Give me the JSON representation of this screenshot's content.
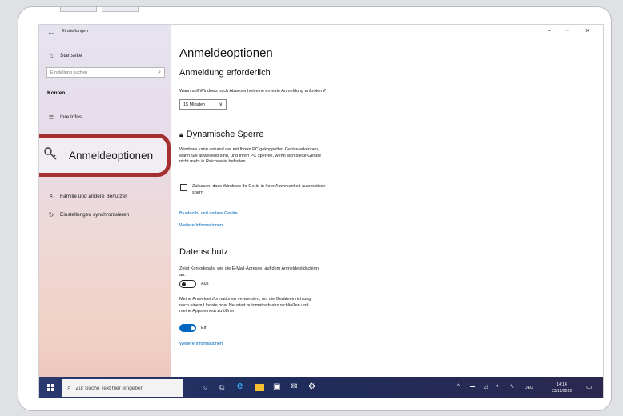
{
  "sidebar": {
    "window_title": "Einstellungen",
    "home": "Startseite",
    "search_placeholder": "Einstellung suchen",
    "section": "Konten",
    "items": [
      {
        "label": "Ihre Infos",
        "icon": "person-list-icon"
      },
      {
        "label": "Anmeldeoptionen",
        "icon": "key-icon"
      },
      {
        "label": "Familie und andere Benutzer",
        "icon": "person-add-icon"
      },
      {
        "label": "Einstellungen synchronisieren",
        "icon": "sync-icon"
      }
    ]
  },
  "main": {
    "title": "Anmeldeoptionen",
    "signin_required": {
      "heading": "Anmeldung erforderlich",
      "question": "Wann soll Windows nach Abwesenheit eine erneute Anmeldung anfordern?",
      "dropdown_value": "15 Minuten"
    },
    "dynamic_lock": {
      "heading": "Dynamische Sperre",
      "description_lines": [
        "Windows kann anhand der mit Ihrem PC gekoppelten Geräte erkennen,",
        "wann Sie abwesend sind, und Ihren PC sperren, wenn sich diese Geräte",
        "nicht mehr in Reichweite befinden."
      ],
      "checkbox_lines": [
        "Zulassen, dass Windows Ihr Gerät in Ihrer Abwesenheit automatisch",
        "sperrt"
      ],
      "link_devices": "Bluetooth- und andere Geräte",
      "link_more": "Weitere Informationen"
    },
    "privacy": {
      "heading": "Datenschutz",
      "account_details_lines": [
        "Zeigt Kontodetails, wie die E-Mail-Adresse, auf dem Anmeldebildschirm",
        "an."
      ],
      "toggle1_label": "Aus",
      "signin_info_lines": [
        "Meine Anmeldeinformationen verwenden, um die Geräteeinrichtung",
        "nach einem Update oder Neustart automatisch abzuschließen und",
        "meine Apps erneut zu öffnen"
      ],
      "toggle2_label": "Ein",
      "link_more": "Weitere Informationen"
    }
  },
  "window_controls": {
    "minimize": "–",
    "maximize": "▫",
    "close": "×"
  },
  "taskbar": {
    "search_placeholder": "Zur Suche Text hier eingeben",
    "language": "DEU",
    "time": "14:14",
    "date": "23/12/2019"
  },
  "colors": {
    "accent": "#0067c0",
    "highlight_border": "#a4302f",
    "taskbar": "#1f2d5c"
  }
}
